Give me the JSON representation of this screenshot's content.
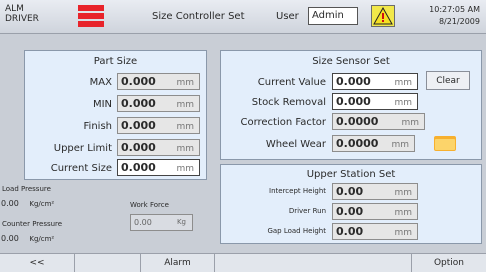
{
  "header": {
    "alarm_label_line1": "ALM",
    "alarm_label_line2": "DRIVER",
    "title": "Size Controller Set",
    "user_label": "User",
    "user_value": "Admin",
    "time": "10:27:05 AM",
    "date": "8/21/2009",
    "flag_color": "#e8232a"
  },
  "part_size": {
    "title": "Part Size",
    "rows": [
      {
        "label": "MAX",
        "value": "0.000",
        "unit": "mm"
      },
      {
        "label": "MIN",
        "value": "0.000",
        "unit": "mm"
      },
      {
        "label": "Finish",
        "value": "0.000",
        "unit": "mm"
      },
      {
        "label": "Upper Limit",
        "value": "0.000",
        "unit": "mm"
      },
      {
        "label": "Current Size",
        "value": "0.000",
        "unit": "mm"
      }
    ]
  },
  "sensor": {
    "title": "Size Sensor Set",
    "rows": [
      {
        "label": "Current Value",
        "value": "0.000",
        "unit": "mm"
      },
      {
        "label": "Stock Removal",
        "value": "0.000",
        "unit": "mm"
      },
      {
        "label": "Correction Factor",
        "value": "0.0000",
        "unit": "mm"
      },
      {
        "label": "Wheel Wear",
        "value": "0.0000",
        "unit": "mm"
      }
    ],
    "clear_label": "Clear"
  },
  "pressure": {
    "load_label": "Load Pressure",
    "load_value": "0.00",
    "load_unit": "Kg/cm²",
    "counter_label": "Counter Pressure",
    "counter_value": "0.00",
    "counter_unit": "Kg/cm²",
    "work_force_label": "Work Force",
    "work_force_value": "0.00",
    "work_force_unit": "Kg"
  },
  "upper_station": {
    "title": "Upper Station Set",
    "rows": [
      {
        "label": "Intercept Height",
        "value": "0.00",
        "unit": "mm"
      },
      {
        "label": "Driver Run",
        "value": "0.00",
        "unit": "mm"
      },
      {
        "label": "Gap Load Height",
        "value": "0.00",
        "unit": "mm"
      }
    ]
  },
  "footer": {
    "back_label": "<<",
    "alarm_label": "Alarm",
    "option_label": "Option"
  }
}
